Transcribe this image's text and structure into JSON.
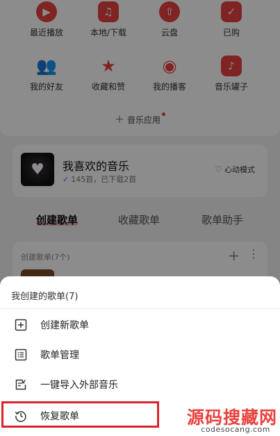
{
  "grid": {
    "row1": [
      {
        "label": "最近播放",
        "icon": "play-icon"
      },
      {
        "label": "本地/下载",
        "icon": "music-note-icon"
      },
      {
        "label": "云盘",
        "icon": "cloud-upload-icon"
      },
      {
        "label": "已购",
        "icon": "purchased-bag-icon"
      }
    ],
    "row2": [
      {
        "label": "我的好友",
        "icon": "friends-icon"
      },
      {
        "label": "收藏和赞",
        "icon": "star-icon"
      },
      {
        "label": "我的播客",
        "icon": "broadcast-icon"
      },
      {
        "label": "音乐罐子",
        "icon": "music-jar-icon"
      }
    ],
    "app_entry": "音乐应用"
  },
  "liked": {
    "title": "我喜欢的音乐",
    "subtitle": "145首，已下载2首",
    "mode_label": "心动模式"
  },
  "tabs": [
    "创建歌单",
    "收藏歌单",
    "歌单助手"
  ],
  "created": {
    "header": "创建歌单(7个)"
  },
  "sheet": {
    "title": "我创建的歌单(7)",
    "items": [
      {
        "label": "创建新歌单",
        "icon": "add-square-icon"
      },
      {
        "label": "歌单管理",
        "icon": "list-manage-icon"
      },
      {
        "label": "一键导入外部音乐",
        "icon": "import-icon"
      },
      {
        "label": "恢复歌单",
        "icon": "history-restore-icon"
      }
    ]
  },
  "watermark": {
    "cn": "源码搜藏网",
    "en": "codesocang.com"
  },
  "colors": {
    "accent": "#e8433f",
    "highlight": "#d8232a"
  }
}
